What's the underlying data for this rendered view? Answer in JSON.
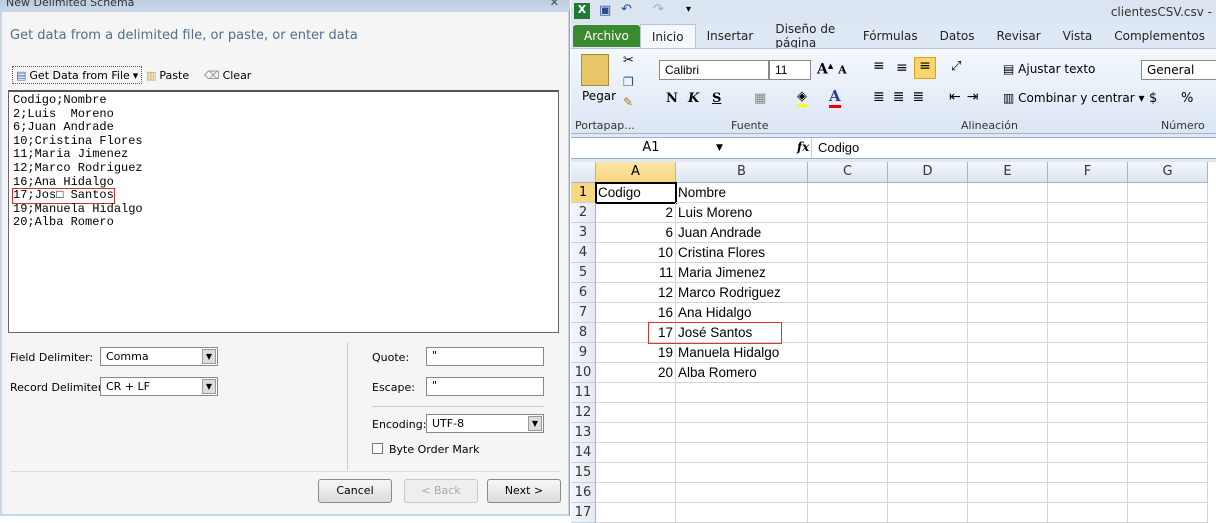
{
  "dialog": {
    "title": "New Delimited Schema",
    "heading": "Get data from a delimited file, or paste, or enter data",
    "toolbar": {
      "get_data": "Get Data from File",
      "paste": "Paste",
      "clear": "Clear"
    },
    "lines": [
      "Codigo;Nombre",
      "2;Luis  Moreno",
      "6;Juan Andrade",
      "10;Cristina Flores",
      "11;Maria Jimenez",
      "12;Marco Rodriguez",
      "16;Ana Hidalgo",
      "17;Jos□ Santos",
      "19;Manuela Hidalgo",
      "20;Alba Romero"
    ],
    "field_delimiter_label": "Field Delimiter:",
    "field_delimiter": "Comma",
    "record_delimiter_label": "Record Delimiter:",
    "record_delimiter": "CR + LF",
    "quote_label": "Quote:",
    "quote": "\"",
    "escape_label": "Escape:",
    "escape": "\"",
    "encoding_label": "Encoding:",
    "encoding": "UTF-8",
    "bom_label": "Byte Order Mark",
    "cancel": "Cancel",
    "back": "< Back",
    "next": "Next >"
  },
  "excel": {
    "title": "clientesCSV.csv -",
    "tabs": [
      "Archivo",
      "Inicio",
      "Insertar",
      "Diseño de página",
      "Fórmulas",
      "Datos",
      "Revisar",
      "Vista",
      "Complementos"
    ],
    "ribbon": {
      "paste": "Pegar",
      "font": "Calibri",
      "size": "11",
      "bold": "N",
      "italic": "K",
      "underline": "S",
      "wrap": "Ajustar texto",
      "merge": "Combinar y centrar",
      "format": "General",
      "currency": "$",
      "percent": "%",
      "groups": [
        "Portapap...",
        "Fuente",
        "Alineación",
        "Número"
      ]
    },
    "namebox": "A1",
    "fx": "fx",
    "formula": "Codigo",
    "columns": [
      "A",
      "B",
      "C",
      "D",
      "E",
      "F",
      "G"
    ],
    "rows": [
      [
        "Codigo",
        "Nombre"
      ],
      [
        "2",
        "Luis  Moreno"
      ],
      [
        "6",
        "Juan Andrade"
      ],
      [
        "10",
        "Cristina Flores"
      ],
      [
        "11",
        "Maria Jimenez"
      ],
      [
        "12",
        "Marco Rodriguez"
      ],
      [
        "16",
        "Ana Hidalgo"
      ],
      [
        "17",
        "José Santos"
      ],
      [
        "19",
        "Manuela Hidalgo"
      ],
      [
        "20",
        "Alba Romero"
      ],
      [
        "",
        ""
      ],
      [
        "",
        ""
      ],
      [
        "",
        ""
      ],
      [
        "",
        ""
      ],
      [
        "",
        ""
      ],
      [
        "",
        ""
      ],
      [
        "",
        ""
      ]
    ],
    "row_numbers": [
      "1",
      "2",
      "3",
      "4",
      "5",
      "6",
      "7",
      "8",
      "9",
      "10",
      "11",
      "12",
      "13",
      "14",
      "15",
      "16",
      "17"
    ]
  }
}
